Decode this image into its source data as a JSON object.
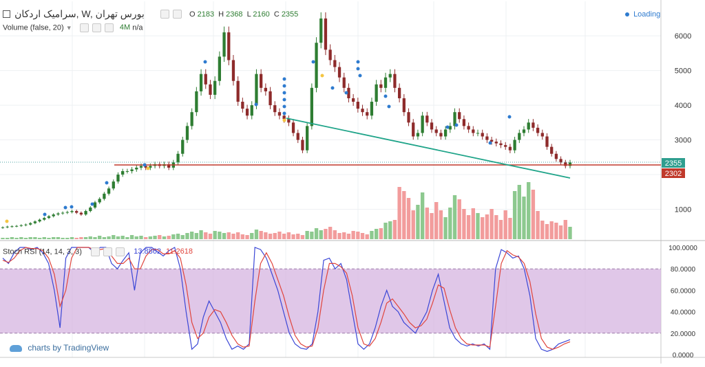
{
  "header": {
    "symbol": "سرامیک اردکان, W, بورس تهران",
    "ohlc": [
      {
        "key": "O",
        "value": "2183"
      },
      {
        "key": "H",
        "value": "2368"
      },
      {
        "key": "L",
        "value": "2160"
      },
      {
        "key": "C",
        "value": "2355"
      }
    ],
    "loading": "Loading"
  },
  "volume_legend": {
    "name": "Volume (false, 20)",
    "value": "4M",
    "extra": "n/a"
  },
  "stoch_legend": {
    "name": "Stoch RSI (14, 14, 3, 3)",
    "k": "13.8862",
    "d": "11.2618"
  },
  "branding": "charts by TradingView",
  "price_labels": {
    "last": "2355",
    "line": "2302"
  },
  "colors": {
    "up": "#2e7d32",
    "down": "#8e2b2b",
    "trendline": "#1fa489",
    "hline": "#c0392b",
    "band": "#d6b4e0",
    "k": "#3a46d6",
    "d": "#e0443c",
    "vol_up": "#8dc98f",
    "vol_down": "#f29c9c"
  },
  "chart_data": [
    {
      "type": "candlestick",
      "y_ticks": [
        1000,
        2000,
        3000,
        4000,
        5000,
        6000
      ],
      "y_tick_labels": [
        "1000",
        "",
        "3000",
        "4000",
        "5000",
        "6000"
      ],
      "ylim": [
        0,
        6700
      ],
      "close": [
        480,
        500,
        510,
        520,
        540,
        560,
        600,
        650,
        700,
        750,
        800,
        850,
        880,
        900,
        920,
        950,
        900,
        850,
        950,
        1050,
        1200,
        1300,
        1450,
        1600,
        1800,
        2000,
        2100,
        2100,
        2150,
        2200,
        2250,
        2200,
        2250,
        2300,
        2250,
        2300,
        2200,
        2350,
        2600,
        3000,
        3400,
        3800,
        4400,
        4900,
        4600,
        4300,
        4700,
        5400,
        6100,
        5300,
        4700,
        4100,
        3900,
        3700,
        4000,
        4900,
        4500,
        4400,
        4000,
        3800,
        3700,
        3600,
        3500,
        3200,
        3000,
        2700,
        3400,
        4500,
        5800,
        6500,
        5600,
        5300,
        5100,
        4800,
        4500,
        4200,
        4100,
        3900,
        3800,
        3700,
        4100,
        4600,
        4500,
        4800,
        4900,
        4500,
        4200,
        3800,
        3500,
        3100,
        3200,
        3700,
        3500,
        3300,
        3200,
        3100,
        3300,
        3400,
        3800,
        3600,
        3400,
        3300,
        3200,
        3200,
        3100,
        3000,
        2950,
        2900,
        2850,
        2800,
        2700,
        3000,
        3200,
        3300,
        3500,
        3350,
        3200,
        3100,
        2800,
        2600,
        2450,
        2350,
        2250,
        2350
      ]
    },
    {
      "type": "bar",
      "name": "Volume",
      "values": [
        0.2,
        0.2,
        0.3,
        0.2,
        0.3,
        0.2,
        0.3,
        0.3,
        0.2,
        0.3,
        0.2,
        0.3,
        0.3,
        0.2,
        0.2,
        0.3,
        0.2,
        0.3,
        0.3,
        0.4,
        0.3,
        0.5,
        0.3,
        0.4,
        0.6,
        0.4,
        0.5,
        0.3,
        0.6,
        0.4,
        0.5,
        0.3,
        0.4,
        0.5,
        0.6,
        0.4,
        0.5,
        0.7,
        0.8,
        0.6,
        0.9,
        1.1,
        0.9,
        1.3,
        1.0,
        0.8,
        1.2,
        1.1,
        0.9,
        1.0,
        0.8,
        1.0,
        0.7,
        0.6,
        0.9,
        1.4,
        1.2,
        1.0,
        0.8,
        0.9,
        1.1,
        0.8,
        1.0,
        0.7,
        0.8,
        0.6,
        1.2,
        1.1,
        1.6,
        1.3,
        1.5,
        1.8,
        1.3,
        0.9,
        1.0,
        0.8,
        1.2,
        1.1,
        0.9,
        0.7,
        1.2,
        1.5,
        1.6,
        2.4,
        2.6,
        2.8,
        7.6,
        7.0,
        6.0,
        4.2,
        5.0,
        6.8,
        4.6,
        3.8,
        5.4,
        4.2,
        3.2,
        4.6,
        6.4,
        5.8,
        4.4,
        3.5,
        4.5,
        3.8,
        3.2,
        3.6,
        4.4,
        3.5,
        2.8,
        4.2,
        3.1,
        7.0,
        7.9,
        6.2,
        8.3,
        7.2,
        4.1,
        2.7,
        2.2,
        2.6,
        2.4,
        2.0,
        2.8,
        1.8
      ]
    },
    {
      "type": "line",
      "name": "Stoch RSI",
      "ylim": [
        0,
        100
      ],
      "y_tick_labels": [
        "100.0000",
        "80.0000",
        "60.0000",
        "40.0000",
        "20.0000",
        "0.0000"
      ],
      "band": [
        20,
        80
      ],
      "series": [
        {
          "name": "K",
          "values": [
            90,
            85,
            95,
            100,
            100,
            98,
            100,
            95,
            85,
            60,
            25,
            90,
            100,
            100,
            100,
            100,
            95,
            100,
            100,
            85,
            80,
            88,
            95,
            60,
            95,
            100,
            100,
            96,
            92,
            97,
            100,
            80,
            40,
            5,
            10,
            35,
            50,
            40,
            30,
            15,
            5,
            8,
            5,
            10,
            100,
            98,
            90,
            75,
            60,
            40,
            20,
            10,
            6,
            5,
            10,
            40,
            88,
            90,
            80,
            85,
            70,
            40,
            10,
            5,
            10,
            25,
            45,
            60,
            45,
            40,
            30,
            25,
            20,
            30,
            40,
            60,
            75,
            50,
            25,
            15,
            10,
            8,
            10,
            8,
            10,
            5,
            80,
            98,
            95,
            90,
            92,
            80,
            55,
            15,
            5,
            3,
            5,
            10,
            12,
            14
          ]
        },
        {
          "name": "D",
          "values": [
            88,
            86,
            90,
            97,
            100,
            99,
            99,
            97,
            90,
            75,
            45,
            60,
            90,
            100,
            100,
            100,
            98,
            98,
            99,
            92,
            85,
            85,
            90,
            80,
            80,
            92,
            98,
            98,
            94,
            94,
            97,
            90,
            65,
            30,
            15,
            20,
            35,
            42,
            40,
            30,
            18,
            10,
            7,
            8,
            50,
            85,
            95,
            85,
            70,
            55,
            35,
            18,
            10,
            7,
            8,
            25,
            60,
            85,
            85,
            82,
            76,
            55,
            25,
            10,
            8,
            15,
            30,
            48,
            52,
            45,
            38,
            30,
            25,
            27,
            33,
            48,
            65,
            62,
            42,
            25,
            15,
            10,
            9,
            9,
            9,
            7,
            45,
            85,
            97,
            93,
            91,
            85,
            68,
            38,
            15,
            7,
            5,
            7,
            10,
            12
          ]
        }
      ]
    }
  ]
}
